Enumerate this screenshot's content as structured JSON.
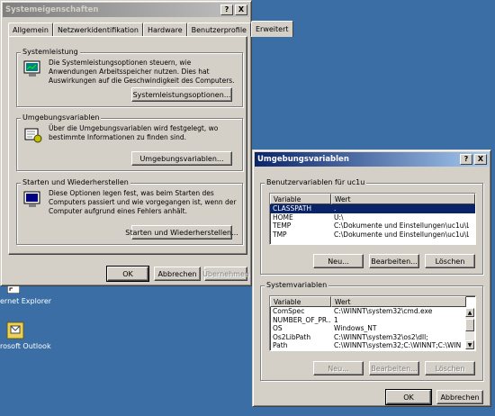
{
  "desktop": {
    "icons": [
      {
        "label": "ernet Explorer"
      },
      {
        "label": "rosoft Outlook"
      }
    ]
  },
  "sysprops": {
    "title": "Systemeigenschaften",
    "help_btn": "?",
    "close_btn": "X",
    "tabs": [
      "Allgemein",
      "Netzwerkidentifikation",
      "Hardware",
      "Benutzerprofile",
      "Erweitert"
    ],
    "selected_tab": "Erweitert",
    "groups": {
      "performance": {
        "label": "Systemleistung",
        "text": "Die Systemleistungsoptionen steuern, wie Anwendungen Arbeitsspeicher nutzen. Dies hat Auswirkungen auf die Geschwindigkeit des Computers.",
        "button": "Systemleistungsoptionen..."
      },
      "environment": {
        "label": "Umgebungsvariablen",
        "text": "Über die Umgebungsvariablen wird festgelegt, wo bestimmte Informationen zu finden sind.",
        "button": "Umgebungsvariablen..."
      },
      "startup": {
        "label": "Starten und Wiederherstellen",
        "text": "Diese Optionen legen fest, was beim Starten des Computers passiert und wie vorgegangen ist, wenn der Computer aufgrund eines Fehlers anhält.",
        "button": "Starten und Wiederherstellen..."
      }
    },
    "buttons": {
      "ok": "OK",
      "cancel": "Abbrechen",
      "apply": "Übernehmen"
    }
  },
  "envvars": {
    "title": "Umgebungsvariablen",
    "help_btn": "?",
    "close_btn": "X",
    "user_group": {
      "label": "Benutzervariablen für uc1u",
      "columns": [
        "Variable",
        "Wert"
      ],
      "rows": [
        {
          "variable": "CLASSPATH",
          "value": ".",
          "selected": true
        },
        {
          "variable": "HOME",
          "value": "U:\\"
        },
        {
          "variable": "TEMP",
          "value": "C:\\Dokumente und Einstellungen\\uc1u\\Lo"
        },
        {
          "variable": "TMP",
          "value": "C:\\Dokumente und Einstellungen\\uc1u\\Lo"
        }
      ],
      "buttons": {
        "new": "Neu...",
        "edit": "Bearbeiten...",
        "delete": "Löschen"
      }
    },
    "system_group": {
      "label": "Systemvariablen",
      "columns": [
        "Variable",
        "Wert"
      ],
      "rows": [
        {
          "variable": "ComSpec",
          "value": "C:\\WINNT\\system32\\cmd.exe"
        },
        {
          "variable": "NUMBER_OF_PR...",
          "value": "1"
        },
        {
          "variable": "OS",
          "value": "Windows_NT"
        },
        {
          "variable": "Os2LibPath",
          "value": "C:\\WINNT\\system32\\os2\\dll;"
        },
        {
          "variable": "Path",
          "value": "C:\\WINNT\\system32;C:\\WINNT;C:\\WIN"
        }
      ],
      "buttons": {
        "new": "Neu...",
        "edit": "Bearbeiten...",
        "delete": "Löschen"
      }
    },
    "footer_buttons": {
      "ok": "OK",
      "cancel": "Abbrechen"
    }
  }
}
